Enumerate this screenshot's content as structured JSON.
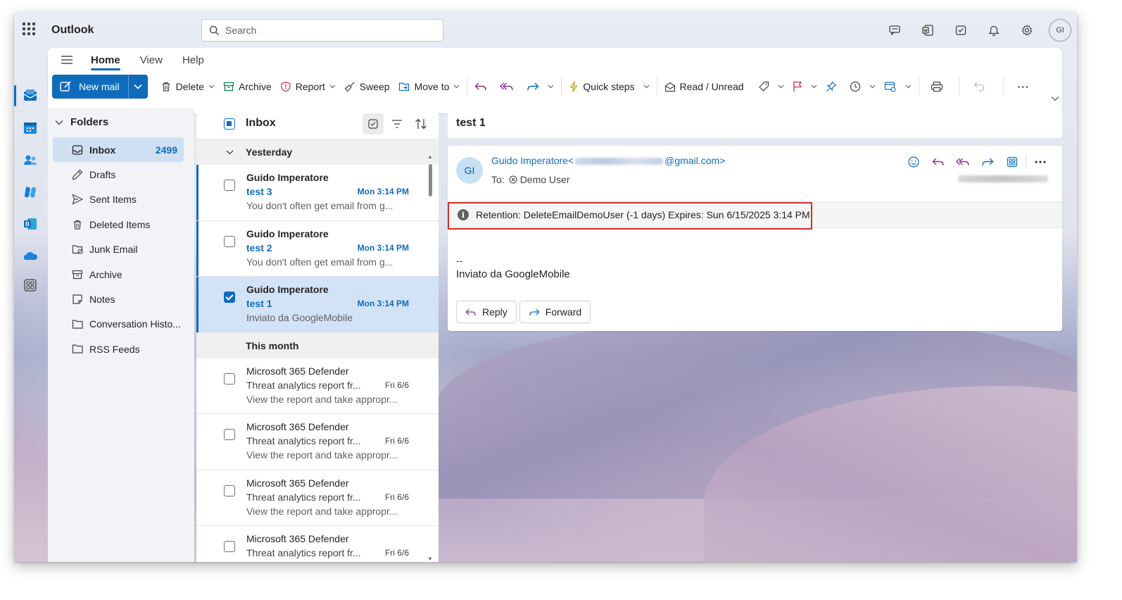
{
  "app": {
    "title": "Outlook"
  },
  "search": {
    "placeholder": "Search"
  },
  "topbar": {
    "icons": [
      "chat-icon",
      "word-icon",
      "tasks-icon",
      "bell-icon",
      "settings-gear-icon"
    ],
    "avatar_initials": "GI"
  },
  "rail": {
    "icons": [
      "mail-icon",
      "calendar-icon",
      "people-icon",
      "copilot-icon",
      "bookings-icon",
      "onedrive-icon",
      "apps-icon"
    ]
  },
  "ribbon": {
    "tabs": [
      {
        "label": "Home",
        "active": true
      },
      {
        "label": "View"
      },
      {
        "label": "Help"
      }
    ],
    "new_mail": "New mail",
    "delete": "Delete",
    "archive": "Archive",
    "report": "Report",
    "sweep": "Sweep",
    "move_to": "Move to",
    "quick_steps": "Quick steps",
    "read_unread": "Read / Unread",
    "more": "···"
  },
  "folders": {
    "header": "Folders",
    "items": [
      {
        "label": "Inbox",
        "count": "2499",
        "icon": "inbox-icon",
        "selected": true
      },
      {
        "label": "Drafts",
        "icon": "drafts-pencil-icon"
      },
      {
        "label": "Sent Items",
        "icon": "send-icon"
      },
      {
        "label": "Deleted Items",
        "icon": "trash-icon"
      },
      {
        "label": "Junk Email",
        "icon": "junk-folder-icon"
      },
      {
        "label": "Archive",
        "icon": "archive-icon"
      },
      {
        "label": "Notes",
        "icon": "notes-icon"
      },
      {
        "label": "Conversation Histo...",
        "icon": "folder-icon"
      },
      {
        "label": "RSS Feeds",
        "icon": "folder-icon"
      }
    ]
  },
  "message_list": {
    "title": "Inbox",
    "groups": [
      "Yesterday",
      "This month"
    ],
    "messages": [
      {
        "from": "Guido Imperatore",
        "subject": "test 3",
        "time": "Mon 3:14 PM",
        "preview": "You don't often get email from g...",
        "unread": true
      },
      {
        "from": "Guido Imperatore",
        "subject": "test 2",
        "time": "Mon 3:14 PM",
        "preview": "You don't often get email from g...",
        "unread": true
      },
      {
        "from": "Guido Imperatore",
        "subject": "test 1",
        "time": "Mon 3:14 PM",
        "preview": "Inviato da GoogleMobile",
        "unread": true,
        "selected": true
      },
      {
        "from": "Microsoft 365 Defender",
        "subject": "Threat analytics report fr...",
        "time": "Fri 6/6",
        "preview": "View the report and take appropr..."
      },
      {
        "from": "Microsoft 365 Defender",
        "subject": "Threat analytics report fr...",
        "time": "Fri 6/6",
        "preview": "View the report and take appropr..."
      },
      {
        "from": "Microsoft 365 Defender",
        "subject": "Threat analytics report fr...",
        "time": "Fri 6/6",
        "preview": "View the report and take appropr..."
      },
      {
        "from": "Microsoft 365 Defender",
        "subject": "Threat analytics report fr...",
        "time": "Fri 6/6",
        "preview": ""
      }
    ]
  },
  "reading": {
    "subject": "test 1",
    "avatar_initials": "GI",
    "from_name": "Guido Imperatore",
    "from_addr_prefix": "<",
    "from_addr_suffix": "@gmail.com>",
    "to_label": "To:",
    "to_name": "Demo User",
    "retention": "Retention: DeleteEmailDemoUser (-1 days) Expires: Sun 6/15/2025 3:14 PM",
    "body_sig": "--",
    "body_text": "Inviato da GoogleMobile",
    "reply": "Reply",
    "forward": "Forward"
  },
  "colors": {
    "accent": "#0f6cbd",
    "highlight_box": "#d32f2f",
    "selected_row": "#d3e3f7"
  }
}
